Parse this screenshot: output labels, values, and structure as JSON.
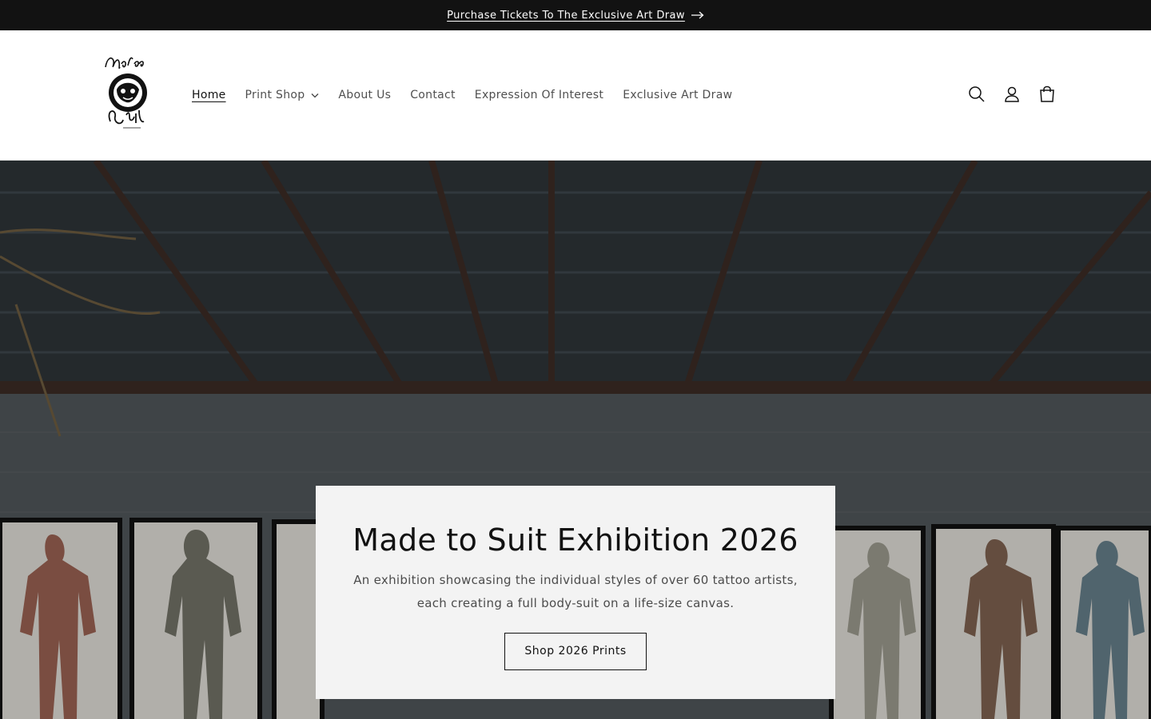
{
  "announcement": {
    "text": "Purchase Tickets To The Exclusive Art Draw",
    "icon": "arrow-right-icon"
  },
  "header": {
    "logo_alt": "Made to Suit",
    "nav": [
      {
        "label": "Home",
        "active": true
      },
      {
        "label": "Print Shop",
        "has_dropdown": true
      },
      {
        "label": "About Us"
      },
      {
        "label": "Contact"
      },
      {
        "label": "Expression Of Interest"
      },
      {
        "label": "Exclusive Art Draw"
      }
    ],
    "icons": [
      "search-icon",
      "account-icon",
      "cart-icon"
    ]
  },
  "hero": {
    "title": "Made to Suit Exhibition 2026",
    "text": "An exhibition showcasing the individual styles of over 60 tattoo artists, each creating a full body-suit on a life-size canvas.",
    "button_label": "Shop 2026 Prints"
  },
  "colors": {
    "announcement_bg": "#121212",
    "text": "#121212",
    "hero_box_bg": "#f3f3f3"
  }
}
